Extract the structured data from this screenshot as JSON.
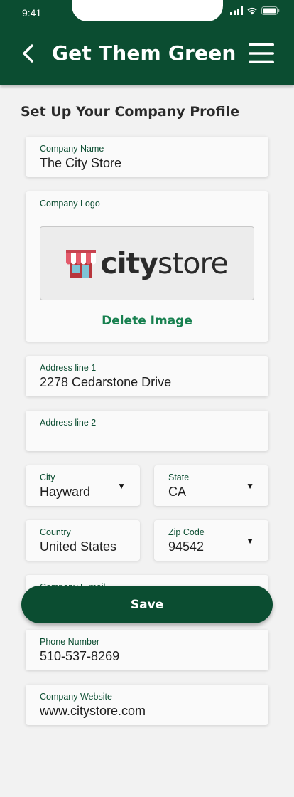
{
  "status_bar": {
    "time": "9:41",
    "icons": [
      "signal-icon",
      "wifi-icon",
      "battery-icon"
    ]
  },
  "header": {
    "title": "Get Them Green",
    "back_icon": "chevron-left-icon",
    "menu_icon": "hamburger-menu-icon",
    "background_color": "#0b4d31"
  },
  "form": {
    "title": "Set Up Your Company Profile",
    "company_name": {
      "label": "Company Name",
      "value": "The City Store"
    },
    "company_logo": {
      "label": "Company Logo",
      "logo_text_bold": "city",
      "logo_text_regular": "store",
      "delete_label": "Delete Image"
    },
    "address_line_1": {
      "label": "Address line 1",
      "value": "2278 Cedarstone Drive"
    },
    "address_line_2": {
      "label": "Address line 2",
      "value": ""
    },
    "city": {
      "label": "City",
      "value": "Hayward"
    },
    "state": {
      "label": "State",
      "value": "CA"
    },
    "country": {
      "label": "Country",
      "value": "United States"
    },
    "zip_code": {
      "label": "Zip Code",
      "value": "94542"
    },
    "company_email": {
      "label": "Company E-mail"
    },
    "phone_number": {
      "label": "Phone Number",
      "value": "510-537-8269"
    },
    "company_website": {
      "label": "Company Website",
      "value": "www.citystore.com"
    },
    "dropdown_caret": "▼"
  },
  "actions": {
    "save_label": "Save"
  },
  "colors": {
    "primary": "#0b4d31",
    "accent_link": "#17804f",
    "label": "#0b4d31",
    "background": "#f2f2f2"
  }
}
